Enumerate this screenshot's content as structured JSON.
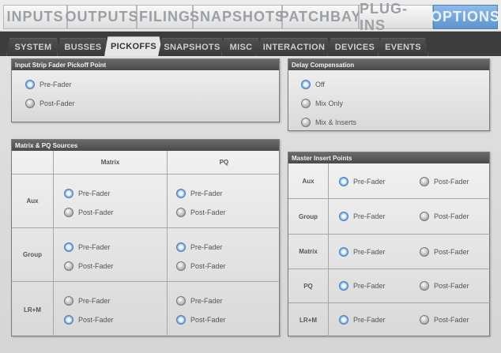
{
  "top_tabs": [
    {
      "label": "INPUTS"
    },
    {
      "label": "OUTPUTS"
    },
    {
      "label": "FILING"
    },
    {
      "label": "SNAPSHOTS"
    },
    {
      "label": "PATCHBAY"
    },
    {
      "label": "PLUG-INS"
    },
    {
      "label": "OPTIONS",
      "active": true
    }
  ],
  "sub_tabs": [
    {
      "label": "SYSTEM"
    },
    {
      "label": "BUSSES"
    },
    {
      "label": "PICKOFFS",
      "active": true
    },
    {
      "label": "SNAPSHOTS"
    },
    {
      "label": "MISC"
    },
    {
      "label": "INTERACTION"
    },
    {
      "label": "DEVICES"
    },
    {
      "label": "EVENTS"
    }
  ],
  "input_strip": {
    "title": "Input Strip Fader Pickoff Point",
    "options": [
      {
        "label": "Pre-Fader",
        "selected": true
      },
      {
        "label": "Post-Fader",
        "selected": false
      }
    ]
  },
  "delay": {
    "title": "Delay Compensation",
    "options": [
      {
        "label": "Off",
        "selected": true
      },
      {
        "label": "Mix Only",
        "selected": false
      },
      {
        "label": "Mix & Inserts",
        "selected": false
      }
    ]
  },
  "matrix_pq": {
    "title": "Matrix & PQ Sources",
    "columns": [
      "Matrix",
      "PQ"
    ],
    "rows": [
      {
        "label": "Aux",
        "matrix": {
          "pre": "Pre-Fader",
          "post": "Post-Fader",
          "selected": "pre"
        },
        "pq": {
          "pre": "Pre-Fader",
          "post": "Post-Fader",
          "selected": "pre"
        }
      },
      {
        "label": "Group",
        "matrix": {
          "pre": "Pre-Fader",
          "post": "Post-Fader",
          "selected": "pre"
        },
        "pq": {
          "pre": "Pre-Fader",
          "post": "Post-Fader",
          "selected": "pre"
        }
      },
      {
        "label": "LR+M",
        "matrix": {
          "pre": "Pre-Fader",
          "post": "Post-Fader",
          "selected": "post"
        },
        "pq": {
          "pre": "Pre-Fader",
          "post": "Post-Fader",
          "selected": "post"
        }
      }
    ]
  },
  "master_insert": {
    "title": "Master Insert Points",
    "rows": [
      {
        "label": "Aux",
        "pre": "Pre-Fader",
        "post": "Post-Fader",
        "selected": "pre"
      },
      {
        "label": "Group",
        "pre": "Pre-Fader",
        "post": "Post-Fader",
        "selected": "pre"
      },
      {
        "label": "Matrix",
        "pre": "Pre-Fader",
        "post": "Post-Fader",
        "selected": "pre"
      },
      {
        "label": "PQ",
        "pre": "Pre-Fader",
        "post": "Post-Fader",
        "selected": "pre"
      },
      {
        "label": "LR+M",
        "pre": "Pre-Fader",
        "post": "Post-Fader",
        "selected": "pre"
      }
    ]
  },
  "colors": {
    "accent": "#5e93cc",
    "title_bar": "#555555",
    "background": "#d9d9d9"
  }
}
